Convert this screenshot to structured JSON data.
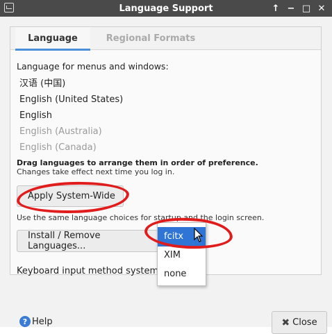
{
  "window": {
    "title": "Language Support",
    "controls": [
      "↑",
      "−",
      "□",
      "✕"
    ]
  },
  "tabs": [
    {
      "label": "Language",
      "active": true
    },
    {
      "label": "Regional Formats",
      "active": false
    }
  ],
  "language_section": {
    "heading": "Language for menus and windows:",
    "languages": [
      {
        "label": "汉语 (中国)",
        "dim": false
      },
      {
        "label": "English (United States)",
        "dim": false
      },
      {
        "label": "English",
        "dim": false
      },
      {
        "label": "English (Australia)",
        "dim": true
      },
      {
        "label": "English (Canada)",
        "dim": true
      }
    ],
    "drag_hint": "Drag languages to arrange them in order of preference.",
    "changes_hint": "Changes take effect next time you log in."
  },
  "apply_button": "Apply System-Wide",
  "same_hint": "Use the same language choices for startup and the login screen.",
  "install_button": "Install / Remove Languages...",
  "keyboard_label": "Keyboard input method system:",
  "input_method_dropdown": {
    "options": [
      "fcitx",
      "XIM",
      "none"
    ],
    "selected": "fcitx"
  },
  "footer": {
    "help_label": "Help",
    "close_label": "Close"
  },
  "colors": {
    "accent": "#4a90d9",
    "selection": "#2f75d6",
    "annotation": "#e01c1c",
    "titlebar": "#4a4a4a"
  }
}
